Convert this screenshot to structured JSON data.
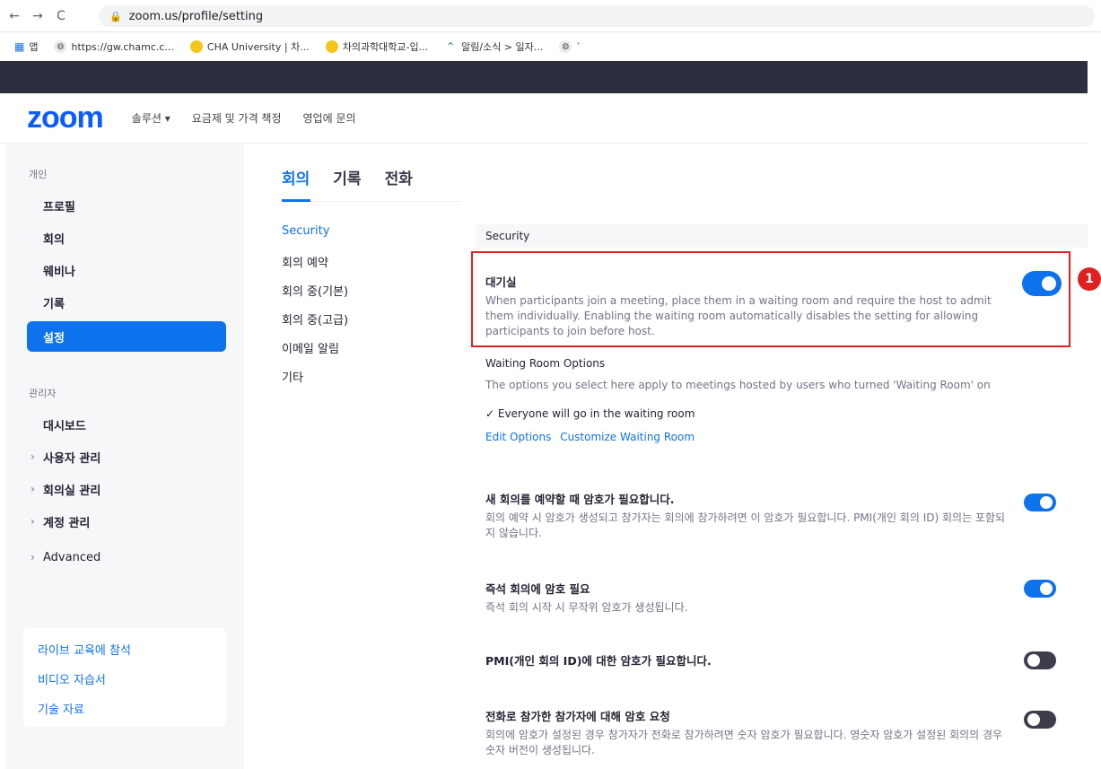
{
  "browser": {
    "url": "zoom.us/profile/setting",
    "bookmarks": [
      "앱",
      "https://gw.chamc.c...",
      "CHA University | 차...",
      "차의과학대학교-입...",
      "알림/소식 > 일자...",
      "`"
    ]
  },
  "header": {
    "logo": "zoom",
    "nav": [
      "솔루션 ▾",
      "요금제 및 가격 책정",
      "영업에 문의"
    ]
  },
  "sidebar": {
    "personal_label": "개인",
    "personal_items": [
      "프로필",
      "회의",
      "웨비나",
      "기록",
      "설정"
    ],
    "admin_label": "관리자",
    "admin_items": [
      "대시보드",
      "사용자 관리",
      "회의실 관리",
      "계정 관리",
      "Advanced"
    ],
    "help_links": [
      "라이브 교육에 참석",
      "비디오 자습서",
      "기술 자료"
    ]
  },
  "tabs": [
    "회의",
    "기록",
    "전화"
  ],
  "subnav": [
    "Security",
    "회의 예약",
    "회의 중(기본)",
    "회의 중(고급)",
    "이메일 알림",
    "기타"
  ],
  "section_header": "Security",
  "waiting_room": {
    "title": "대기실",
    "desc": "When participants join a meeting, place them in a waiting room and require the host to admit them individually. Enabling the waiting room automatically disables the setting for allowing participants to join before host.",
    "enabled": true
  },
  "callout_number": "1",
  "waiting_room_options": {
    "title": "Waiting Room Options",
    "desc": "The options you select here apply to meetings hosted by users who turned 'Waiting Room' on",
    "check": "✓ Everyone will go in the waiting room",
    "edit_link": "Edit Options",
    "customize_link": "Customize Waiting Room"
  },
  "settings": [
    {
      "title": "새 회의를 예약할 때 암호가 필요합니다.",
      "desc": "회의 예약 시 암호가 생성되고 참가자는 회의에 참가하려면 이 암호가 필요합니다. PMI(개인 회의 ID) 회의는 포함되지 않습니다.",
      "enabled": true
    },
    {
      "title": "즉석 회의에 암호 필요",
      "desc": "즉석 회의 시작 시 무작위 암호가 생성됩니다.",
      "enabled": true
    },
    {
      "title": "PMI(개인 회의 ID)에 대한 암호가 필요합니다.",
      "desc": "",
      "enabled": false
    },
    {
      "title": "전화로 참가한 참가자에 대해 암호 요청",
      "desc": "회의에 암호가 설정된 경우 참가자가 전화로 참가하려면 숫자 암호가 필요합니다. 영숫자 암호가 설정된 회의의 경우 숫자 버전이 생성됩니다.",
      "enabled": false
    }
  ],
  "colors": {
    "accent": "#0e72ed",
    "highlight": "#e02020",
    "toggle_off": "#3d3d4e"
  }
}
